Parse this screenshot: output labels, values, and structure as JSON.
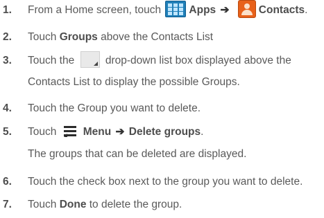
{
  "steps": [
    {
      "num": "1.",
      "t1": "From a Home screen, touch",
      "icon1": "apps-grid-icon",
      "b1": "Apps",
      "arrow": "➔",
      "icon2": "contacts-icon",
      "b2": "Contacts",
      "t2": "."
    },
    {
      "num": "2.",
      "t1": "Touch",
      "b1": "Groups",
      "t2": "above the Contacts List"
    },
    {
      "num": "3.",
      "t1": "Touch the",
      "icon1": "dropdown-box-icon",
      "t2": "drop-down list box displayed above the",
      "line2": "Contacts List to display the possible Groups."
    },
    {
      "num": "4.",
      "t1": "Touch the Group you want to delete."
    },
    {
      "num": "5.",
      "t1": "Touch",
      "icon1": "menu-icon",
      "b1": "Menu",
      "arrow": "➔",
      "b2": "Delete groups",
      "t2": ".",
      "line2": "The groups that can be deleted are displayed."
    },
    {
      "num": "6.",
      "t1": "Touch the check box next to the group you want to delete."
    },
    {
      "num": "7.",
      "t1": "Touch",
      "b1": "Done",
      "t2": "to delete the group."
    }
  ]
}
